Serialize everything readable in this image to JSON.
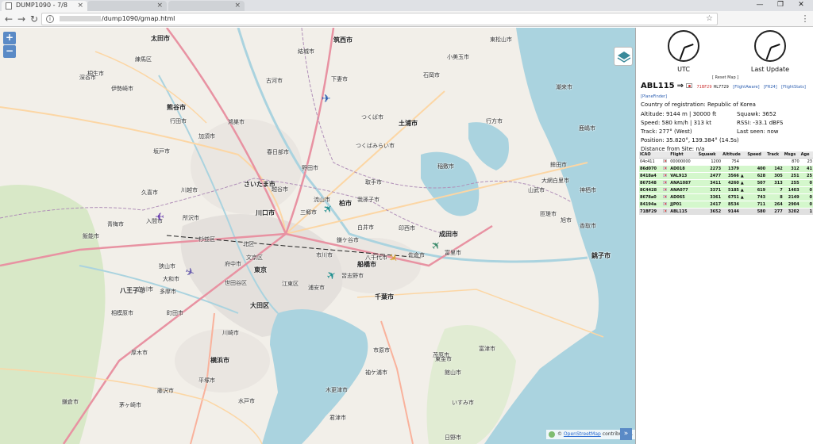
{
  "browser": {
    "tabs": [
      {
        "label": "DUMP1090 - 7/8"
      },
      {
        "label": ""
      },
      {
        "label": ""
      }
    ],
    "url_path": "/dump1090/gmap.html"
  },
  "map": {
    "zoom_in_label": "+",
    "zoom_out_label": "−",
    "attribution_prefix": "©",
    "attribution_link": "OpenStreetMap",
    "attribution_suffix": "contributors.",
    "expand_label": "»",
    "colors": {
      "water": "#aad3df",
      "land": "#f2efe9",
      "urban": "#e0dcd8",
      "forest": "#cde6b8",
      "motorway": "#e892a2",
      "trunk": "#f9b29c",
      "primary": "#fcd6a4"
    },
    "labels": [
      {
        "text": "太田市",
        "big": true
      },
      {
        "text": "結城市",
        "big": false
      },
      {
        "text": "筑西市",
        "big": true
      },
      {
        "text": "下妻市",
        "big": false
      },
      {
        "text": "古河市",
        "big": false
      },
      {
        "text": "つくば市",
        "big": false
      },
      {
        "text": "土浦市",
        "big": true
      },
      {
        "text": "石岡市",
        "big": false
      },
      {
        "text": "小美玉市",
        "big": false
      },
      {
        "text": "行方市",
        "big": false
      },
      {
        "text": "つくばみらい市",
        "big": false
      },
      {
        "text": "春日部市",
        "big": false
      },
      {
        "text": "野田市",
        "big": false
      },
      {
        "text": "稲敷市",
        "big": false
      },
      {
        "text": "取手市",
        "big": false
      },
      {
        "text": "さいたま市",
        "big": true
      },
      {
        "text": "越谷市",
        "big": false
      },
      {
        "text": "川越市",
        "big": false
      },
      {
        "text": "柏市",
        "big": true
      },
      {
        "text": "流山市",
        "big": false
      },
      {
        "text": "我孫子市",
        "big": false
      },
      {
        "text": "三郷市",
        "big": false
      },
      {
        "text": "川口市",
        "big": true
      },
      {
        "text": "白井市",
        "big": false
      },
      {
        "text": "印西市",
        "big": false
      },
      {
        "text": "成田市",
        "big": true
      },
      {
        "text": "所沢市",
        "big": false
      },
      {
        "text": "鎌ケ谷市",
        "big": false
      },
      {
        "text": "八千代市",
        "big": false
      },
      {
        "text": "佐倉市",
        "big": false
      },
      {
        "text": "富里市",
        "big": false
      },
      {
        "text": "北区",
        "big": false
      },
      {
        "text": "文京区",
        "big": false
      },
      {
        "text": "市川市",
        "big": false
      },
      {
        "text": "船橋市",
        "big": true
      },
      {
        "text": "習志野市",
        "big": false
      },
      {
        "text": "東京",
        "big": true
      },
      {
        "text": "江東区",
        "big": false
      },
      {
        "text": "浦安市",
        "big": false
      },
      {
        "text": "千葉市",
        "big": true
      },
      {
        "text": "世田谷区",
        "big": false
      },
      {
        "text": "大田区",
        "big": true
      },
      {
        "text": "町田市",
        "big": false
      },
      {
        "text": "川崎市",
        "big": false
      },
      {
        "text": "相模原市",
        "big": false
      },
      {
        "text": "横浜市",
        "big": true
      },
      {
        "text": "厚木市",
        "big": false
      },
      {
        "text": "藤沢市",
        "big": false
      },
      {
        "text": "茅ヶ崎市",
        "big": false
      },
      {
        "text": "市原市",
        "big": false
      },
      {
        "text": "木更津市",
        "big": false
      },
      {
        "text": "袖ケ浦市",
        "big": false
      },
      {
        "text": "君津市",
        "big": false
      },
      {
        "text": "茂原市",
        "big": false
      },
      {
        "text": "東金市",
        "big": false
      },
      {
        "text": "いすみ市",
        "big": false
      },
      {
        "text": "銚子市",
        "big": true
      },
      {
        "text": "旭市",
        "big": false
      },
      {
        "text": "匝瑳市",
        "big": false
      },
      {
        "text": "鉾田市",
        "big": false
      },
      {
        "text": "鹿嶋市",
        "big": false
      },
      {
        "text": "神栖市",
        "big": false
      },
      {
        "text": "八王子市",
        "big": true
      },
      {
        "text": "青梅市",
        "big": false
      },
      {
        "text": "飯能市",
        "big": false
      },
      {
        "text": "入間市",
        "big": false
      },
      {
        "text": "狭山市",
        "big": false
      },
      {
        "text": "府中市",
        "big": false
      },
      {
        "text": "杉並区",
        "big": false
      },
      {
        "text": "練馬区",
        "big": false
      },
      {
        "text": "桐生市",
        "big": false
      },
      {
        "text": "伊勢崎市",
        "big": false
      },
      {
        "text": "深谷市",
        "big": false
      },
      {
        "text": "熊谷市",
        "big": true
      },
      {
        "text": "行田市",
        "big": false
      },
      {
        "text": "鴻巣市",
        "big": false
      },
      {
        "text": "加須市",
        "big": false
      },
      {
        "text": "久喜市",
        "big": false
      },
      {
        "text": "坂戸市",
        "big": false
      },
      {
        "text": "東松山市",
        "big": false
      },
      {
        "text": "水戸市",
        "big": false
      },
      {
        "text": "鎌倉市",
        "big": false
      },
      {
        "text": "平塚市",
        "big": false
      },
      {
        "text": "大和市",
        "big": false
      },
      {
        "text": "多摩市",
        "big": false
      },
      {
        "text": "立川市",
        "big": false
      },
      {
        "text": "日野市",
        "big": false
      },
      {
        "text": "館山市",
        "big": false
      },
      {
        "text": "富津市",
        "big": false
      },
      {
        "text": "大網白里市",
        "big": false
      },
      {
        "text": "山武市",
        "big": false
      },
      {
        "text": "香取市",
        "big": false
      },
      {
        "text": "潮来市",
        "big": false
      }
    ]
  },
  "sidebar": {
    "clock_utc_label": "UTC",
    "clock_last_label": "Last Update",
    "reset_map": "[ Reset Map ]",
    "selected": {
      "callsign": "ABL115",
      "arrow": "⇒",
      "hex": "71BF29",
      "registration": "HL7729",
      "link_flightaware": "[FlightAware]",
      "link_fr24": "[FR24]",
      "link_flightstats": "[FlightStats]",
      "link_planefinder": "[PlaneFinder]",
      "country": "Country of registration: Republic of Korea",
      "altitude": "Altitude: 9144 m | 30000 ft",
      "squawk": "Squawk: 3652",
      "speed": "Speed: 580 km/h | 313 kt",
      "rssi": "RSSI: -33.1 dBFS",
      "track": "Track: 277° (West)",
      "last_seen": "Last seen: now",
      "position": "Position: 35.820°, 139.384° (14.5s)",
      "distance": "Distance from Site: n/a"
    },
    "table": {
      "headers": [
        "ICAO",
        "",
        "Flight",
        "Squawk",
        "Altitude",
        "Speed",
        "Track",
        "Msgs",
        "Age"
      ],
      "rows": [
        {
          "icao": "04c411",
          "flight": "00000000",
          "squawk": "1200",
          "altitude": "754",
          "climb": "",
          "speed": "",
          "track": "",
          "msgs": "870",
          "age": "23",
          "state": "stale"
        },
        {
          "icao": "86d070",
          "flight": "AD018",
          "squawk": "2273",
          "altitude": "1379",
          "climb": "",
          "speed": "400",
          "track": "142",
          "msgs": "312",
          "age": "41",
          "state": "valid"
        },
        {
          "icao": "8418a4",
          "flight": "VAL913",
          "squawk": "2477",
          "altitude": "3566",
          "climb": "▲",
          "speed": "628",
          "track": "305",
          "msgs": "251",
          "age": "25",
          "state": "valid"
        },
        {
          "icao": "867548",
          "flight": "ANA1087",
          "squawk": "3411",
          "altitude": "4260",
          "climb": "▲",
          "speed": "507",
          "track": "313",
          "msgs": "255",
          "age": "0",
          "state": "valid"
        },
        {
          "icao": "8C4428",
          "flight": "ANA077",
          "squawk": "3371",
          "altitude": "5185",
          "climb": "▲",
          "speed": "619",
          "track": "7",
          "msgs": "1403",
          "age": "0",
          "state": "valid"
        },
        {
          "icao": "8678a0",
          "flight": "AD065",
          "squawk": "3361",
          "altitude": "6751",
          "climb": "▲",
          "speed": "743",
          "track": "8",
          "msgs": "2149",
          "age": "0",
          "state": "valid"
        },
        {
          "icao": "84194a",
          "flight": "JJP01",
          "squawk": "2417",
          "altitude": "8534",
          "climb": "",
          "speed": "711",
          "track": "264",
          "msgs": "2904",
          "age": "0",
          "state": "valid"
        },
        {
          "icao": "71BF29",
          "flight": "ABL115",
          "squawk": "3652",
          "altitude": "9144",
          "climb": "",
          "speed": "580",
          "track": "277",
          "msgs": "3202",
          "age": "1",
          "state": "selected"
        }
      ]
    }
  }
}
